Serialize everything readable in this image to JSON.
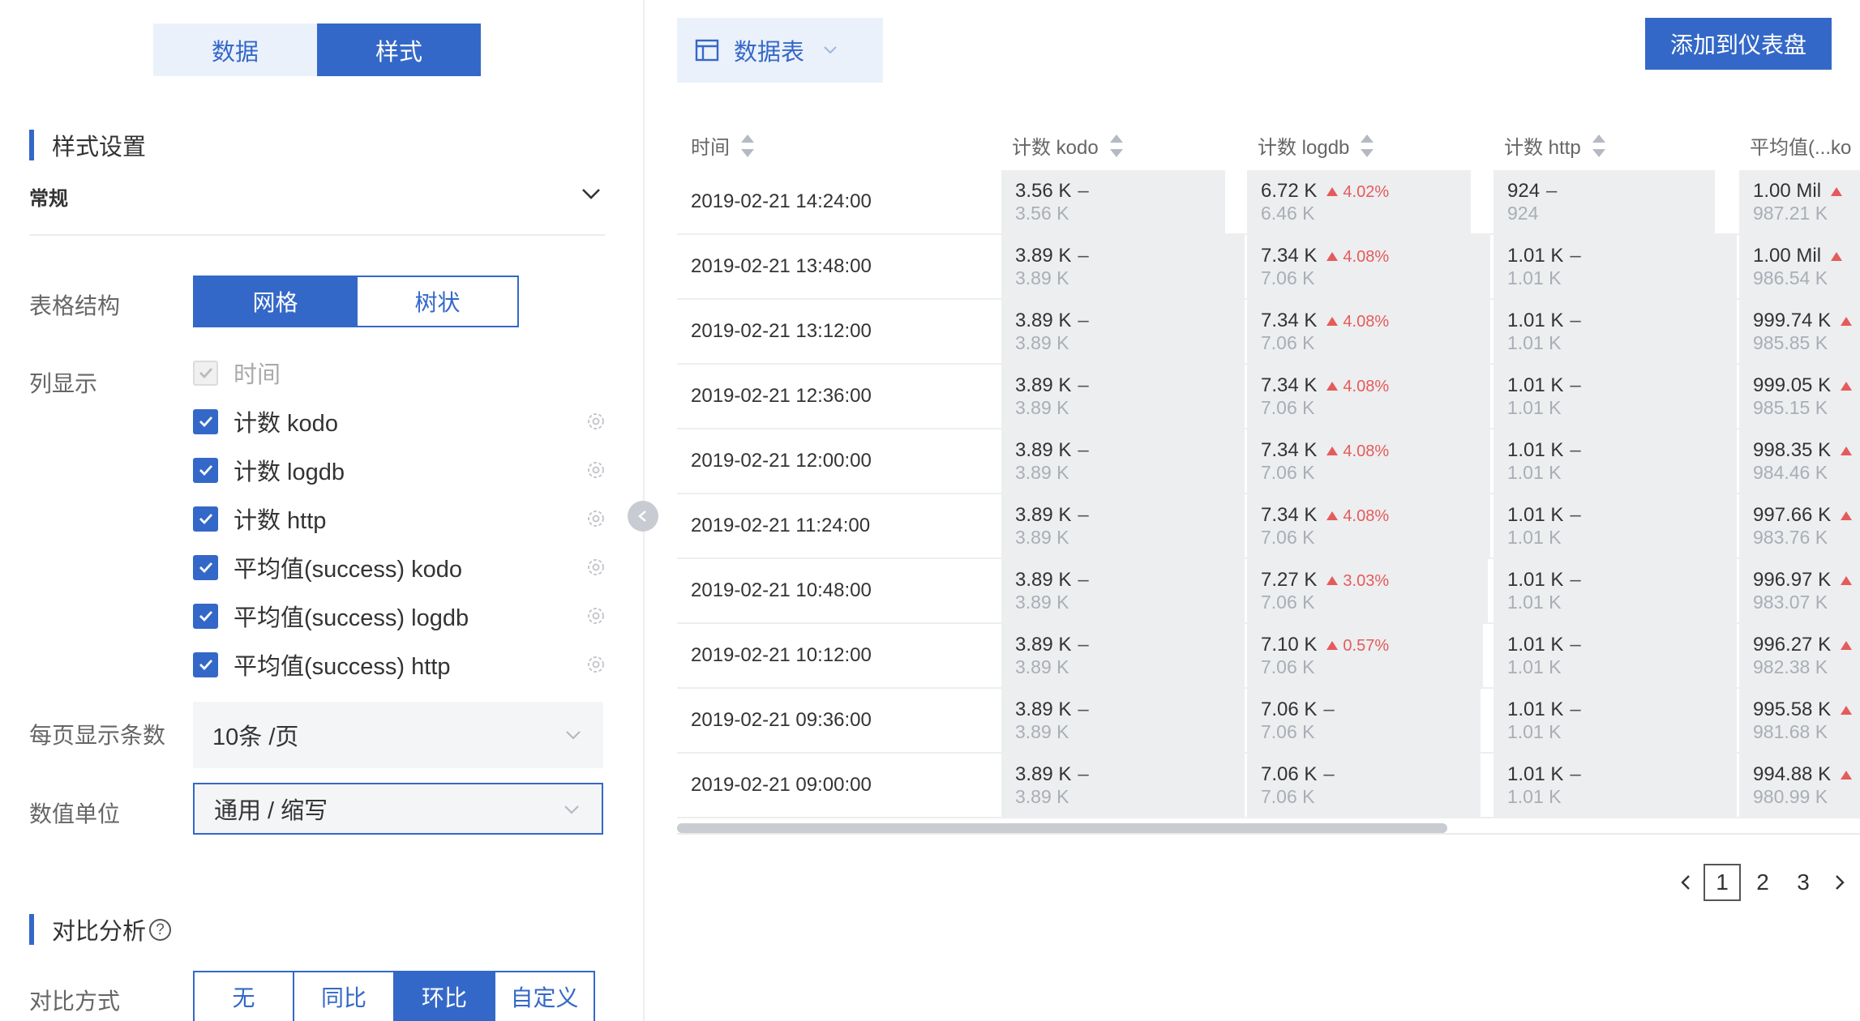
{
  "left_panel": {
    "tabs": {
      "data": "数据",
      "style": "样式"
    },
    "style_settings_title": "样式设置",
    "general_label": "常规",
    "table_structure": {
      "label": "表格结构",
      "options": [
        "网格",
        "树状"
      ],
      "selected": "网格"
    },
    "column_display": {
      "label": "列显示",
      "columns": [
        {
          "label": "时间",
          "checked": true,
          "disabled": true
        },
        {
          "label": "计数 kodo",
          "checked": true
        },
        {
          "label": "计数 logdb",
          "checked": true
        },
        {
          "label": "计数 http",
          "checked": true
        },
        {
          "label": "平均值(success) kodo",
          "checked": true
        },
        {
          "label": "平均值(success) logdb",
          "checked": true
        },
        {
          "label": "平均值(success) http",
          "checked": true
        }
      ]
    },
    "page_size": {
      "label": "每页显示条数",
      "value": "10条 /页"
    },
    "value_unit": {
      "label": "数值单位",
      "value": "通用 / 缩写"
    },
    "compare_title": "对比分析",
    "compare_help": "?",
    "compare_method": {
      "label": "对比方式",
      "options": [
        "无",
        "同比",
        "环比",
        "自定义"
      ],
      "selected": "环比"
    }
  },
  "right_panel": {
    "viz_type": "数据表",
    "add_button": "添加到仪表盘",
    "table": {
      "headers": [
        "时间",
        "计数 kodo",
        "计数 logdb",
        "计数 http",
        "平均值(...ko"
      ],
      "rows": [
        {
          "time": "2019-02-21 14:24:00",
          "kodo": "3.56 K",
          "kodo_prev": "3.56 K",
          "logdb": "6.72 K",
          "logdb_delta": "4.02%",
          "logdb_prev": "6.46 K",
          "http": "924",
          "http_prev": "924",
          "avg": "1.00 Mil",
          "avg_prev": "987.21 K"
        },
        {
          "time": "2019-02-21 13:48:00",
          "kodo": "3.89 K",
          "kodo_prev": "3.89 K",
          "logdb": "7.34 K",
          "logdb_delta": "4.08%",
          "logdb_prev": "7.06 K",
          "http": "1.01 K",
          "http_prev": "1.01 K",
          "avg": "1.00 Mil",
          "avg_prev": "986.54 K"
        },
        {
          "time": "2019-02-21 13:12:00",
          "kodo": "3.89 K",
          "kodo_prev": "3.89 K",
          "logdb": "7.34 K",
          "logdb_delta": "4.08%",
          "logdb_prev": "7.06 K",
          "http": "1.01 K",
          "http_prev": "1.01 K",
          "avg": "999.74 K",
          "avg_prev": "985.85 K"
        },
        {
          "time": "2019-02-21 12:36:00",
          "kodo": "3.89 K",
          "kodo_prev": "3.89 K",
          "logdb": "7.34 K",
          "logdb_delta": "4.08%",
          "logdb_prev": "7.06 K",
          "http": "1.01 K",
          "http_prev": "1.01 K",
          "avg": "999.05 K",
          "avg_prev": "985.15 K"
        },
        {
          "time": "2019-02-21 12:00:00",
          "kodo": "3.89 K",
          "kodo_prev": "3.89 K",
          "logdb": "7.34 K",
          "logdb_delta": "4.08%",
          "logdb_prev": "7.06 K",
          "http": "1.01 K",
          "http_prev": "1.01 K",
          "avg": "998.35 K",
          "avg_prev": "984.46 K"
        },
        {
          "time": "2019-02-21 11:24:00",
          "kodo": "3.89 K",
          "kodo_prev": "3.89 K",
          "logdb": "7.34 K",
          "logdb_delta": "4.08%",
          "logdb_prev": "7.06 K",
          "http": "1.01 K",
          "http_prev": "1.01 K",
          "avg": "997.66 K",
          "avg_prev": "983.76 K"
        },
        {
          "time": "2019-02-21 10:48:00",
          "kodo": "3.89 K",
          "kodo_prev": "3.89 K",
          "logdb": "7.27 K",
          "logdb_delta": "3.03%",
          "logdb_prev": "7.06 K",
          "http": "1.01 K",
          "http_prev": "1.01 K",
          "avg": "996.97 K",
          "avg_prev": "983.07 K"
        },
        {
          "time": "2019-02-21 10:12:00",
          "kodo": "3.89 K",
          "kodo_prev": "3.89 K",
          "logdb": "7.10 K",
          "logdb_delta": "0.57%",
          "logdb_prev": "7.06 K",
          "http": "1.01 K",
          "http_prev": "1.01 K",
          "avg": "996.27 K",
          "avg_prev": "982.38 K"
        },
        {
          "time": "2019-02-21 09:36:00",
          "kodo": "3.89 K",
          "kodo_prev": "3.89 K",
          "logdb": "7.06 K",
          "logdb_delta": "",
          "logdb_prev": "7.06 K",
          "http": "1.01 K",
          "http_prev": "1.01 K",
          "avg": "995.58 K",
          "avg_prev": "981.68 K"
        },
        {
          "time": "2019-02-21 09:00:00",
          "kodo": "3.89 K",
          "kodo_prev": "3.89 K",
          "logdb": "7.06 K",
          "logdb_delta": "",
          "logdb_prev": "7.06 K",
          "http": "1.01 K",
          "http_prev": "1.01 K",
          "avg": "994.88 K",
          "avg_prev": "980.99 K"
        }
      ],
      "kodo_fill": [
        0.92,
        1,
        1,
        1,
        1,
        1,
        1,
        1,
        1,
        1
      ],
      "logdb_fill": [
        0.92,
        1,
        1,
        1,
        1,
        1,
        0.99,
        0.97,
        0.96,
        0.96
      ],
      "http_fill": [
        0.91,
        1,
        1,
        1,
        1,
        1,
        1,
        1,
        1,
        1
      ]
    },
    "pagination": {
      "pages": [
        "1",
        "2",
        "3"
      ],
      "current": "1"
    }
  },
  "colors": {
    "primary": "#3468c8",
    "increase": "#e45b5b",
    "cell_bg": "#edeef0"
  }
}
